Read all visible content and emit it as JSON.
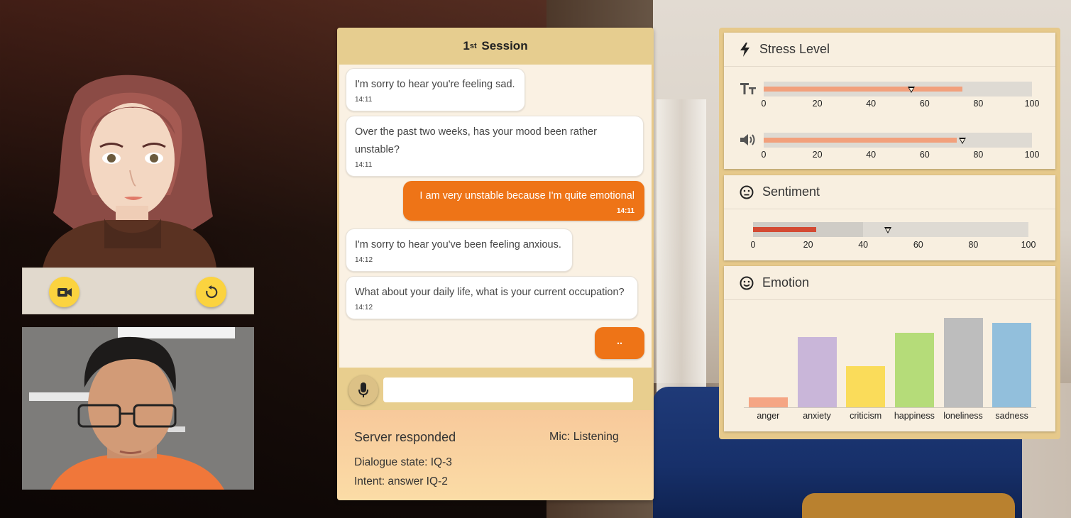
{
  "session": {
    "title_prefix": "1",
    "title_sup": "st",
    "title_suffix": " Session"
  },
  "messages": [
    {
      "role": "bot",
      "text": "I'm sorry to hear you're feeling sad.",
      "time": "14:11"
    },
    {
      "role": "bot",
      "text": "Over the past two weeks, has your mood been rather unstable?",
      "time": "14:11"
    },
    {
      "role": "user",
      "text": "I am very unstable because I'm quite emotional",
      "time": "14:11"
    },
    {
      "role": "bot",
      "text": "I'm sorry to hear you've been feeling anxious.",
      "time": "14:12"
    },
    {
      "role": "bot",
      "text": "What about your daily life, what is your current occupation?",
      "time": "14:12"
    },
    {
      "role": "user",
      "text": "..",
      "time": ""
    }
  ],
  "input": {
    "value": "",
    "placeholder": ""
  },
  "status": {
    "server": "Server responded",
    "mic": "Mic: Listening",
    "dialogue_state": "Dialogue state: IQ-3",
    "intent": "Intent: answer IQ-2"
  },
  "controls": {
    "camera_icon": "video-camera-icon",
    "reset_icon": "reset-icon",
    "button_color": "#fbd33f"
  },
  "stress": {
    "title": "Stress Level",
    "axis_ticks": [
      "0",
      "20",
      "40",
      "60",
      "80",
      "100"
    ],
    "text_fill": 74,
    "text_marker": 55,
    "audio_fill": 72,
    "audio_marker": 74,
    "fill_color": "#f2a07c"
  },
  "sentiment": {
    "title": "Sentiment",
    "axis_ticks": [
      "0",
      "20",
      "40",
      "60",
      "80",
      "100"
    ],
    "fill": 23,
    "band": 40,
    "marker": 49,
    "fill_color": "#d34a33"
  },
  "emotion": {
    "title": "Emotion",
    "chart_type": "bar",
    "categories": [
      "anger",
      "anxiety",
      "criticism",
      "happiness",
      "loneliness",
      "sadness"
    ],
    "values": [
      10,
      72,
      42,
      76,
      91,
      86
    ],
    "colors": [
      "#f5a584",
      "#c9b6d9",
      "#fadc5a",
      "#b5dc79",
      "#bdbdbd",
      "#92bfdc"
    ]
  },
  "chart_data": {
    "type": "bar",
    "title": "Emotion",
    "categories": [
      "anger",
      "anxiety",
      "criticism",
      "happiness",
      "loneliness",
      "sadness"
    ],
    "values": [
      10,
      72,
      42,
      76,
      91,
      86
    ],
    "ylim": [
      0,
      100
    ],
    "xlabel": "",
    "ylabel": ""
  }
}
